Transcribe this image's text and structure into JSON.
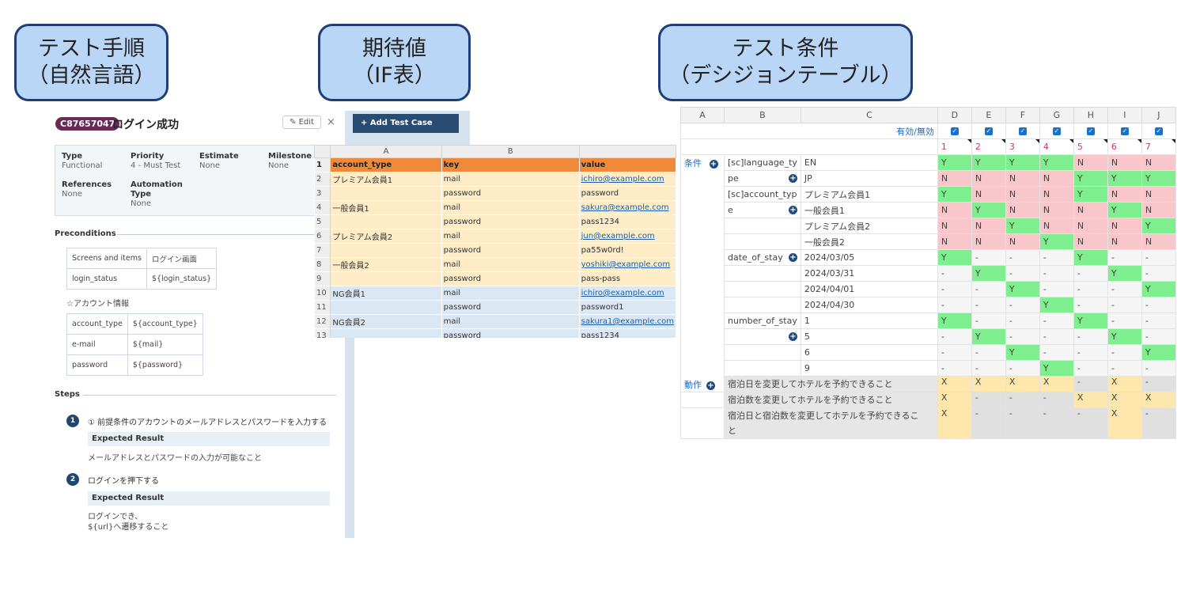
{
  "callouts": [
    {
      "line1": "テスト手順",
      "line2": "（自然言語）"
    },
    {
      "line1": "期待値",
      "line2": "（IF表）"
    },
    {
      "line1": "テスト条件",
      "line2": "（デシジョンテーブル）"
    }
  ],
  "testcase": {
    "id": "C87657047",
    "title": "ログイン成功",
    "edit_label": "Edit",
    "close": "×",
    "meta": {
      "type_label": "Type",
      "type_value": "Functional",
      "priority_label": "Priority",
      "priority_value": "4 - Must Test",
      "estimate_label": "Estimate",
      "estimate_value": "None",
      "milestone_label": "Milestone",
      "milestone_value": "None",
      "references_label": "References",
      "references_value": "None",
      "automation_label": "Automation Type",
      "automation_value": "None"
    },
    "preconditions_label": "Preconditions",
    "precond_rows": [
      [
        "Screens and items",
        "ログイン画面"
      ],
      [
        "login_status",
        "${login_status}"
      ]
    ],
    "account_note": "☆アカウント情報",
    "account_rows": [
      [
        "account_type",
        "${account_type}"
      ],
      [
        "e-mail",
        "${mail}"
      ],
      [
        "password",
        "${password}"
      ]
    ],
    "steps_label": "Steps",
    "steps": [
      {
        "num": "1",
        "text": "① 前提条件のアカウントのメールアドレスとパスワードを入力する",
        "expected_label": "Expected Result",
        "expected": [
          "メールアドレスとパスワードの入力が可能なこと"
        ]
      },
      {
        "num": "2",
        "text": "ログインを押下する",
        "expected_label": "Expected Result",
        "expected": [
          "ログインでき、",
          "${url}へ遷移すること"
        ]
      }
    ]
  },
  "sheet": {
    "add_button": "+ Add Test Case",
    "col_headers": [
      "A",
      "B",
      ""
    ],
    "header": [
      "account_type",
      "key",
      "value"
    ],
    "rows": [
      {
        "n": "2",
        "a": "プレミアム会員1",
        "b": "mail",
        "c": "ichiro@example.com",
        "link": true,
        "tone": "y"
      },
      {
        "n": "3",
        "a": "",
        "b": "password",
        "c": "password",
        "link": false,
        "tone": "y"
      },
      {
        "n": "4",
        "a": "一般会員1",
        "b": "mail",
        "c": "sakura@example.com",
        "link": true,
        "tone": "y"
      },
      {
        "n": "5",
        "a": "",
        "b": "password",
        "c": "pass1234",
        "link": false,
        "tone": "y"
      },
      {
        "n": "6",
        "a": "プレミアム会員2",
        "b": "mail",
        "c": "jun@example.com",
        "link": true,
        "tone": "y"
      },
      {
        "n": "7",
        "a": "",
        "b": "password",
        "c": "pa55w0rd!",
        "link": false,
        "tone": "y"
      },
      {
        "n": "8",
        "a": "一般会員2",
        "b": "mail",
        "c": "yoshiki@example.com",
        "link": true,
        "tone": "y"
      },
      {
        "n": "9",
        "a": "",
        "b": "password",
        "c": "pass-pass",
        "link": false,
        "tone": "y"
      },
      {
        "n": "10",
        "a": "NG会員1",
        "b": "mail",
        "c": "ichiro@example.com",
        "link": true,
        "tone": "b"
      },
      {
        "n": "11",
        "a": "",
        "b": "password",
        "c": "password1",
        "link": false,
        "tone": "b"
      },
      {
        "n": "12",
        "a": "NG会員2",
        "b": "mail",
        "c": "sakura1@example.com",
        "link": true,
        "tone": "b"
      },
      {
        "n": "13",
        "a": "",
        "b": "password",
        "c": "pass1234",
        "link": false,
        "tone": "b"
      }
    ]
  },
  "decision": {
    "col_headers": [
      "A",
      "B",
      "C",
      "D",
      "E",
      "F",
      "G",
      "H",
      "I",
      "J"
    ],
    "enable_label": "有効/無効",
    "case_numbers": [
      "1",
      "2",
      "3",
      "4",
      "5",
      "6",
      "7"
    ],
    "condition_label": "条件",
    "action_label": "動作",
    "rows": [
      {
        "grp": "cond",
        "b": "[sc]language_ty",
        "bplus": false,
        "c": "EN",
        "v": [
          "Y",
          "Y",
          "Y",
          "Y",
          "N",
          "N",
          "N"
        ]
      },
      {
        "grp": "",
        "b": "pe",
        "bplus": true,
        "c": "JP",
        "v": [
          "N",
          "N",
          "N",
          "N",
          "Y",
          "Y",
          "Y"
        ]
      },
      {
        "grp": "",
        "b": "[sc]account_typ",
        "bplus": false,
        "c": "プレミアム会員1",
        "v": [
          "Y",
          "N",
          "N",
          "N",
          "Y",
          "N",
          "N"
        ]
      },
      {
        "grp": "",
        "b": "e",
        "bplus": true,
        "c": "一般会員1",
        "v": [
          "N",
          "Y",
          "N",
          "N",
          "N",
          "Y",
          "N"
        ]
      },
      {
        "grp": "",
        "b": "",
        "bplus": false,
        "c": "プレミアム会員2",
        "v": [
          "N",
          "N",
          "Y",
          "N",
          "N",
          "N",
          "Y"
        ]
      },
      {
        "grp": "",
        "b": "",
        "bplus": false,
        "c": "一般会員2",
        "v": [
          "N",
          "N",
          "N",
          "Y",
          "N",
          "N",
          "N"
        ]
      },
      {
        "grp": "",
        "b": "date_of_stay",
        "bplus": true,
        "c": "2024/03/05",
        "v": [
          "Y",
          "-",
          "-",
          "-",
          "Y",
          "-",
          "-"
        ]
      },
      {
        "grp": "",
        "b": "",
        "bplus": false,
        "c": "2024/03/31",
        "v": [
          "-",
          "Y",
          "-",
          "-",
          "-",
          "Y",
          "-"
        ]
      },
      {
        "grp": "",
        "b": "",
        "bplus": false,
        "c": "2024/04/01",
        "v": [
          "-",
          "-",
          "Y",
          "-",
          "-",
          "-",
          "Y"
        ]
      },
      {
        "grp": "",
        "b": "",
        "bplus": false,
        "c": "2024/04/30",
        "v": [
          "-",
          "-",
          "-",
          "Y",
          "-",
          "-",
          "-"
        ]
      },
      {
        "grp": "",
        "b": "number_of_stay",
        "bplus": false,
        "c": "1",
        "v": [
          "Y",
          "-",
          "-",
          "-",
          "Y",
          "-",
          "-"
        ]
      },
      {
        "grp": "",
        "b": "",
        "bplus": true,
        "c": "5",
        "v": [
          "-",
          "Y",
          "-",
          "-",
          "-",
          "Y",
          "-"
        ]
      },
      {
        "grp": "",
        "b": "",
        "bplus": false,
        "c": "6",
        "v": [
          "-",
          "-",
          "Y",
          "-",
          "-",
          "-",
          "Y"
        ]
      },
      {
        "grp": "",
        "b": "",
        "bplus": false,
        "c": "9",
        "v": [
          "-",
          "-",
          "-",
          "Y",
          "-",
          "-",
          "-"
        ]
      }
    ],
    "actions": [
      {
        "text": "宿泊日を変更してホテルを予約できること",
        "v": [
          "X",
          "X",
          "X",
          "X",
          "-",
          "X",
          "-"
        ]
      },
      {
        "text": "宿泊数を変更してホテルを予約できること",
        "v": [
          "X",
          "-",
          "-",
          "-",
          "X",
          "X",
          "X"
        ]
      },
      {
        "text": "宿泊日と宿泊数を変更してホテルを予約できるこ",
        "text2": "と",
        "v": [
          "X",
          "-",
          "-",
          "-",
          "-",
          "X",
          "-"
        ]
      }
    ]
  }
}
